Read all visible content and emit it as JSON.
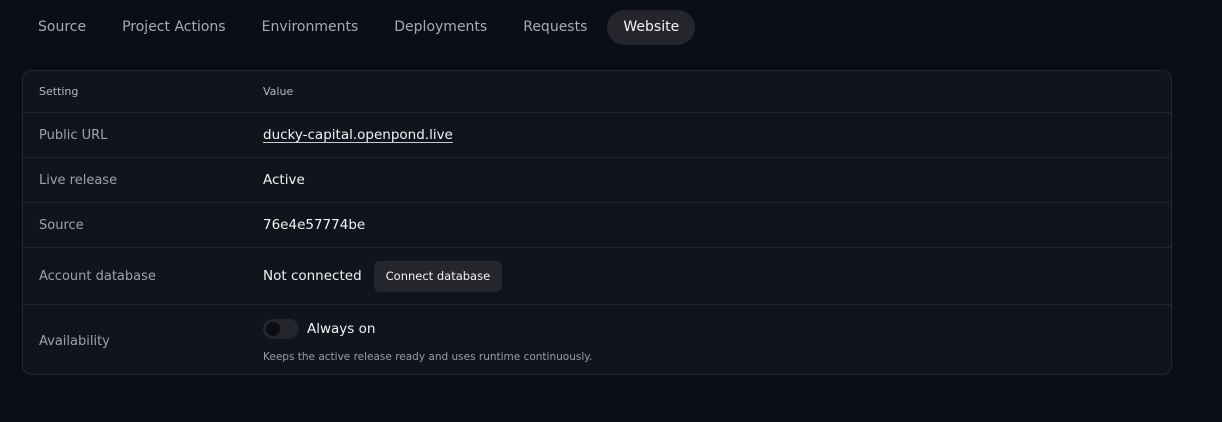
{
  "tabs": [
    {
      "label": "Source",
      "active": false
    },
    {
      "label": "Project Actions",
      "active": false
    },
    {
      "label": "Environments",
      "active": false
    },
    {
      "label": "Deployments",
      "active": false
    },
    {
      "label": "Requests",
      "active": false
    },
    {
      "label": "Website",
      "active": true
    }
  ],
  "table": {
    "headers": {
      "setting": "Setting",
      "value": "Value"
    },
    "rows": {
      "public_url": {
        "label": "Public URL",
        "value": "ducky-capital.openpond.live"
      },
      "live_release": {
        "label": "Live release",
        "value": "Active"
      },
      "source": {
        "label": "Source",
        "value": "76e4e57774be"
      },
      "account_database": {
        "label": "Account database",
        "value": "Not connected",
        "button": "Connect database"
      },
      "availability": {
        "label": "Availability",
        "toggle_label": "Always on",
        "toggle_on": false,
        "hint": "Keeps the active release ready and uses runtime continuously."
      }
    }
  },
  "colors": {
    "background": "#0b0e14",
    "panel": "#11141a",
    "active_tab": "#24262b",
    "text": "#f1f2f4",
    "muted_text": "#9fa2aa"
  }
}
